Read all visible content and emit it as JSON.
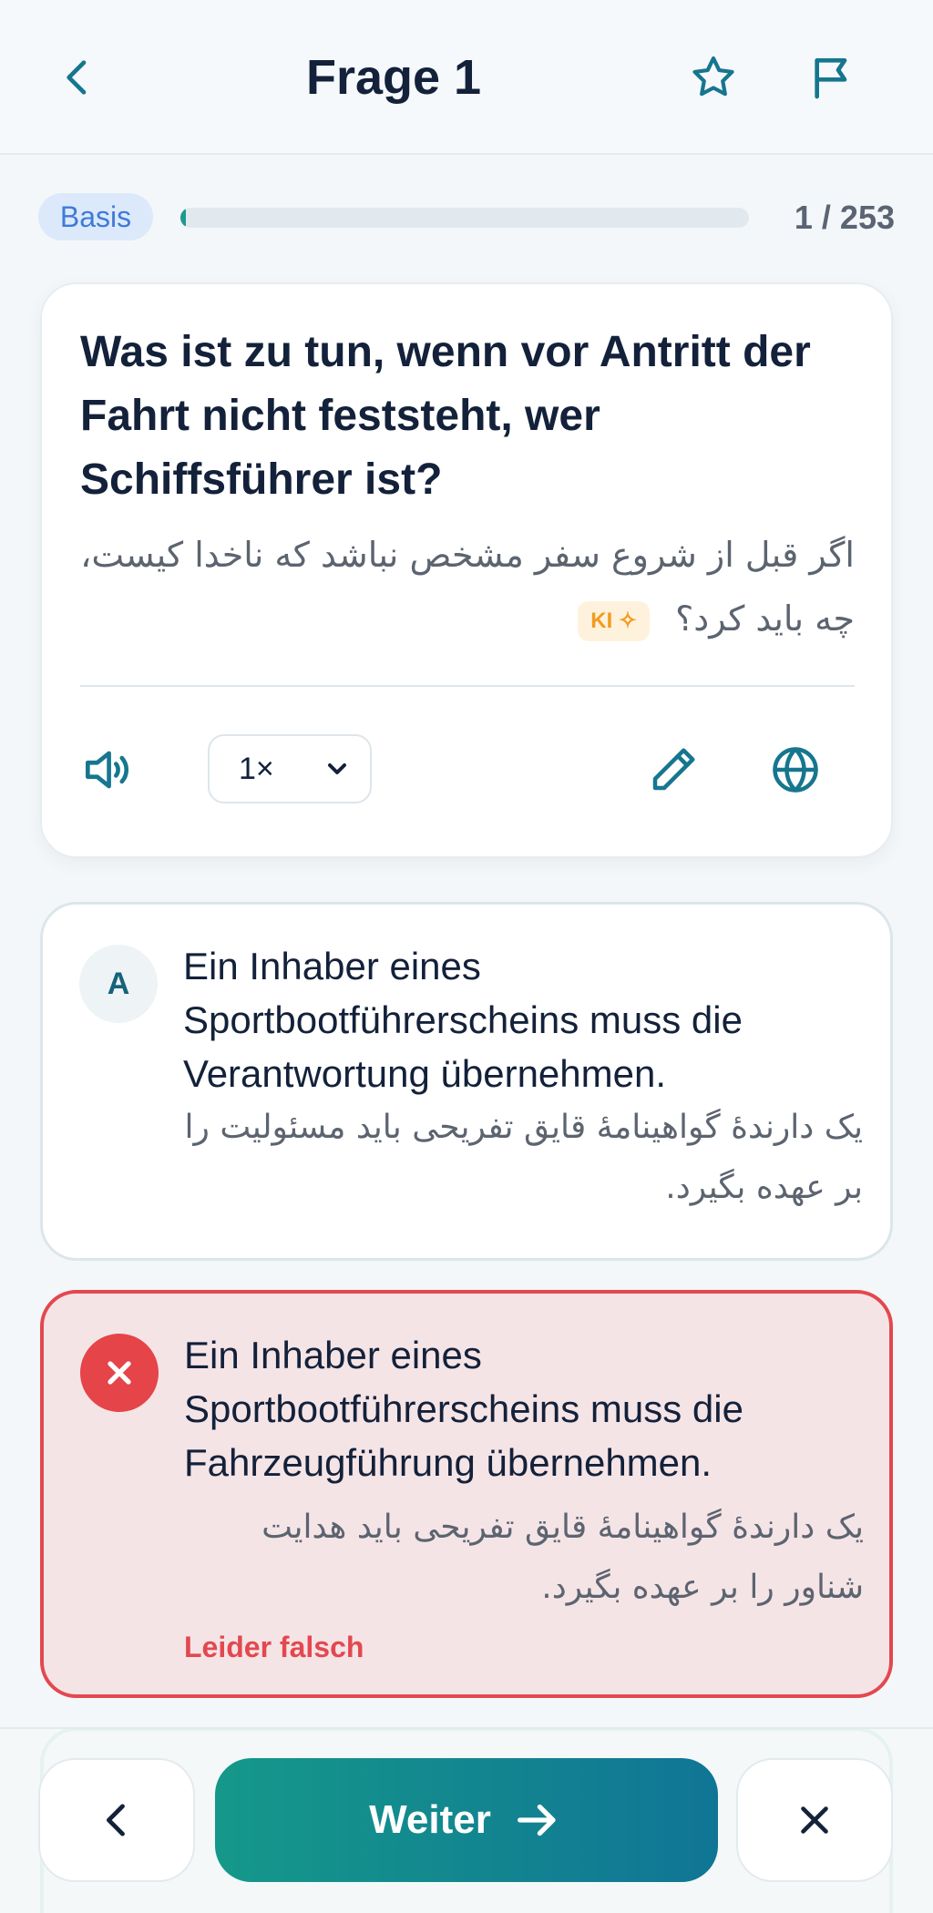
{
  "header": {
    "title": "Frage 1",
    "icons": {
      "back": "chevron-left-icon",
      "favorite": "star-icon",
      "report": "flag-icon"
    }
  },
  "progress": {
    "level": "Basis",
    "current": 1,
    "total": 253,
    "label": "1 / 253",
    "fraction": 0.004
  },
  "question": {
    "text": "Was ist zu tun, wenn vor Antritt der Fahrt nicht feststeht, wer Schiffsführer ist?",
    "translation": "اگر قبل از شروع سفر مشخص نباشد که ناخدا کیست، چه باید کرد؟",
    "ai_badge": "KI ✧"
  },
  "controls": {
    "speed": "1×",
    "icons": {
      "audio": "speaker-icon",
      "edit": "pencil-icon",
      "translate": "globe-icon"
    }
  },
  "answers": [
    {
      "letter": "A",
      "text": "Ein Inhaber eines Sportbootführerscheins muss die Verantwortung übernehmen.",
      "translation": "یک دارندهٔ گواهینامهٔ قایق تفریحی باید مسئولیت را بر عهده بگیرد.",
      "state": "neutral"
    },
    {
      "letter": "",
      "text": "Ein Inhaber eines Sportbootführerscheins muss die Fahrzeugführung übernehmen.",
      "translation": "یک دارندهٔ گواهینامهٔ قایق تفریحی باید هدایت شناور را بر عهده بگیرد.",
      "state": "wrong",
      "feedback": "Leider falsch"
    }
  ],
  "bottom": {
    "next_label": "Weiter"
  },
  "colors": {
    "accent": "#107595",
    "wrong": "#e3484f",
    "correct": "#20a57a",
    "badge": "#3f7ad8"
  }
}
